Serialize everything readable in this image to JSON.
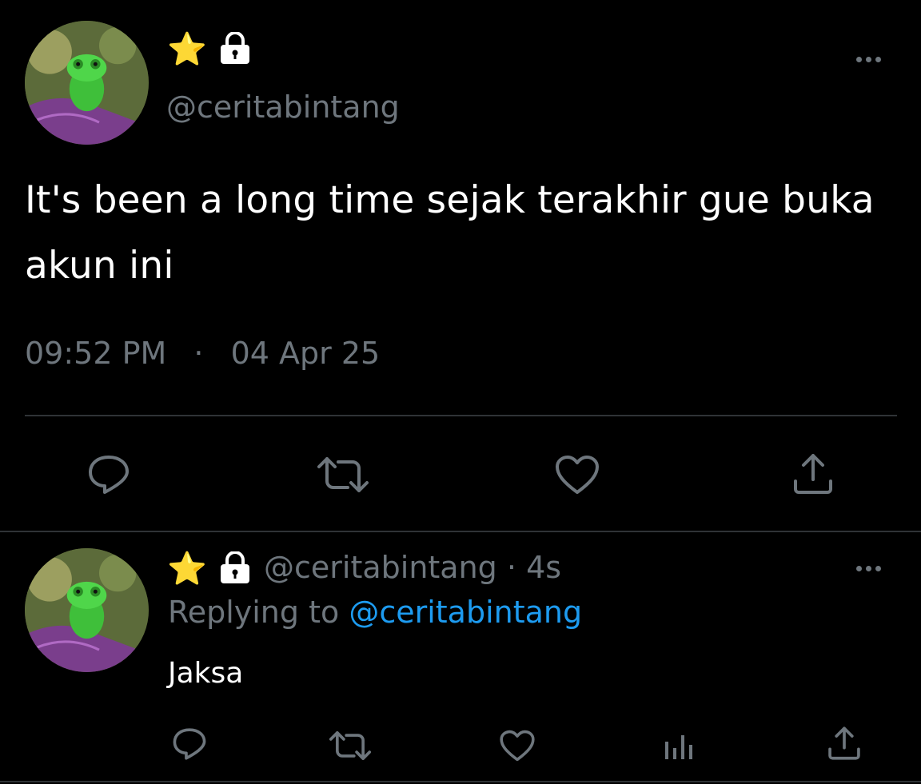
{
  "main_tweet": {
    "handle": "@ceritabintang",
    "text": "It's been a long time sejak terakhir gue buka akun ini",
    "time": "09:52 PM",
    "separator": "·",
    "date": "04 Apr 25",
    "icons": {
      "verified": "star-emoji-icon",
      "protected": "lock-icon",
      "more": "more-options-icon",
      "reply": "reply-icon",
      "retweet": "retweet-icon",
      "like": "like-icon",
      "share": "share-icon"
    }
  },
  "reply_tweet": {
    "handle": "@ceritabintang",
    "dot": "·",
    "age": "4s",
    "replying_prefix": "Replying to",
    "replying_to": "@ceritabintang",
    "text": "Jaksa",
    "icons": {
      "reply": "reply-icon",
      "retweet": "retweet-icon",
      "like": "like-icon",
      "analytics": "analytics-icon",
      "share": "share-icon"
    }
  },
  "colors": {
    "background": "#000000",
    "text": "#ffffff",
    "muted": "#6e767d",
    "link": "#1d9bf0",
    "divider": "#2f3336"
  }
}
